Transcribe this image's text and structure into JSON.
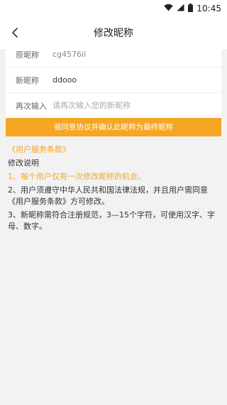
{
  "status_bar": {
    "time": "10:45"
  },
  "header": {
    "title": "修改昵称"
  },
  "form": {
    "original": {
      "label": "原昵称",
      "value": "cg4576il"
    },
    "new_name": {
      "label": "新昵称",
      "value": "ddooo"
    },
    "confirm": {
      "label": "再次输入",
      "placeholder": "请再次输入您的新昵称"
    }
  },
  "confirm_button": {
    "label": "我同意协议并确认此昵称为最终昵称"
  },
  "agreement_link": "《用户服务条款》",
  "instructions": {
    "title": "修改说明",
    "items": [
      "1、每个用户仅有一次修改昵称的机会。",
      "2、用户须遵守中华人民共和国法律法规，并且用户需同意《用户服务条款》方可修改。",
      "3、新昵称需符合注册规范，3—15个字符，可使用汉字、字母、数字。"
    ]
  },
  "colors": {
    "accent": "#f5a623",
    "background": "#f2f2f2"
  }
}
